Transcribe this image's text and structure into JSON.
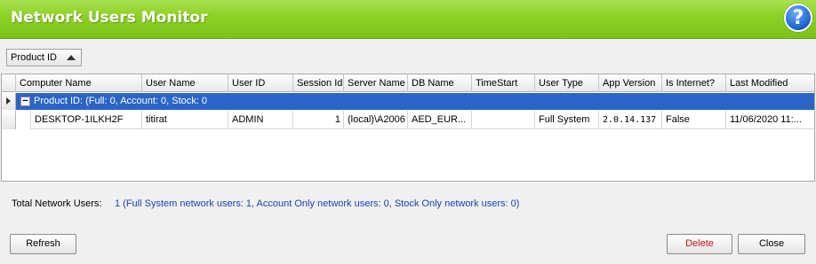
{
  "window": {
    "title": "Network Users Monitor",
    "help_glyph": "?",
    "help_icon": "help-icon"
  },
  "groupby": {
    "label": "Product ID",
    "sort_icon": "sort-ascending-icon"
  },
  "grid": {
    "columns": [
      "Computer Name",
      "User Name",
      "User ID",
      "Session Id",
      "Server Name",
      "DB Name",
      "TimeStart",
      "User Type",
      "App Version",
      "Is Internet?",
      "Last Modified"
    ],
    "group": {
      "label": "Product ID:  (Full: 0, Account: 0, Stock: 0",
      "expander": "−"
    },
    "rows": [
      {
        "computer_name": "DESKTOP-1ILKH2F",
        "user_name": "titirat",
        "user_id": "ADMIN",
        "session_id": "1",
        "server_name": "(local)\\A2006",
        "db_name": "AED_EUR...",
        "time_start": "",
        "user_type": "Full System",
        "app_version": "2.0.14.137",
        "is_internet": "False",
        "last_modified": "11/06/2020 11:..."
      }
    ]
  },
  "summary": {
    "label": "Total Network Users:",
    "value": "1 (Full System network users: 1, Account Only network users: 0, Stock Only network users: 0)"
  },
  "buttons": {
    "refresh": "Refresh",
    "delete": "Delete",
    "close": "Close"
  },
  "colors": {
    "title_bar": "#8cd022",
    "group_row": "#2a64c8",
    "summary_value": "#1a3fbf",
    "delete_text": "#d01010"
  }
}
